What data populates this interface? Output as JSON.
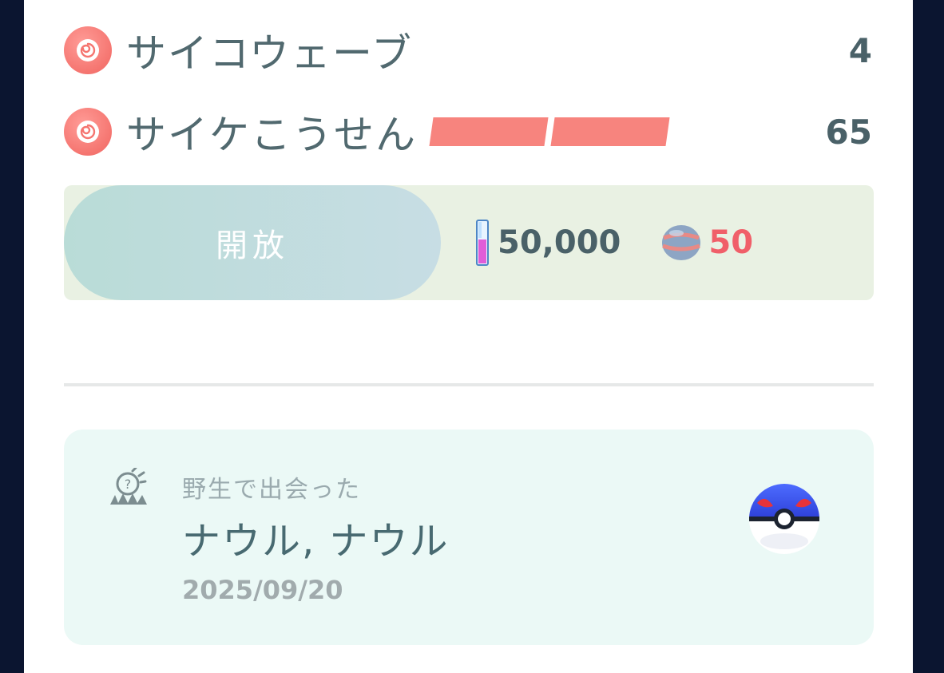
{
  "moves": [
    {
      "name": "サイコウェーブ",
      "power": "4",
      "type_icon": "psychic-type-icon",
      "energy_bars": 0
    },
    {
      "name": "サイケこうせん",
      "power": "65",
      "type_icon": "psychic-type-icon",
      "energy_bars": 2
    }
  ],
  "unlock": {
    "button_label": "開放",
    "stardust_cost": "50,000",
    "candy_cost": "50"
  },
  "origin": {
    "label": "野生で出会った",
    "place": "ナウル, ナウル",
    "date": "2025/09/20",
    "ball": "great-ball-icon"
  },
  "colors": {
    "psychic": "#f57570",
    "energy_bar": "#f7847e",
    "candy_value": "#f05f69",
    "origin_bg": "#ebf9f6",
    "unlock_bg": "#e9f1e3"
  }
}
